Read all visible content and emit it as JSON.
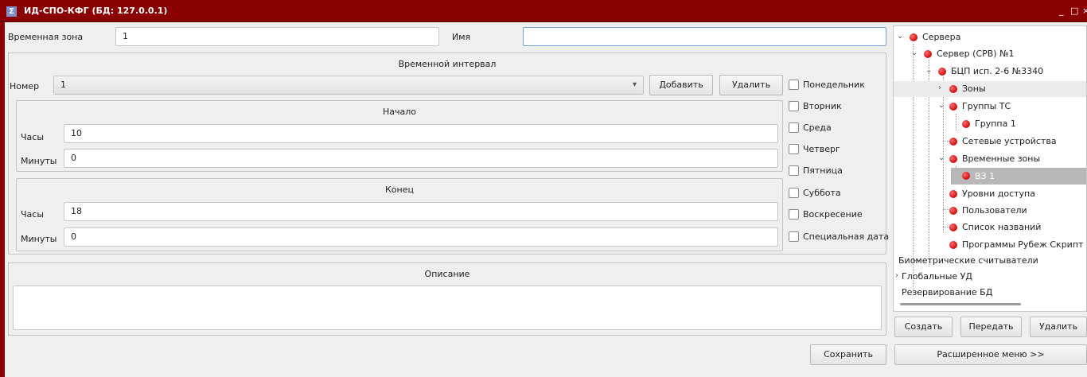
{
  "window": {
    "title": "ИД-СПО-КФГ (БД: 127.0.0.1)",
    "icon": "sigma-icon",
    "minimize": "_",
    "maximize": "□",
    "close": "×",
    "colors": {
      "titlebar": "#8b0000",
      "selection": "#b8b8b8",
      "node": "#d21a1a"
    }
  },
  "form": {
    "timezone_label": "Временная зона",
    "timezone_value": "1",
    "name_label": "Имя",
    "name_value": ""
  },
  "interval": {
    "title": "Временной интервал",
    "number_label": "Номер",
    "number_value": "1",
    "add_button": "Добавить",
    "delete_button": "Удалить",
    "start": {
      "title": "Начало",
      "hours_label": "Часы",
      "hours_value": "10",
      "minutes_label": "Минуты",
      "minutes_value": "0"
    },
    "end": {
      "title": "Конец",
      "hours_label": "Часы",
      "hours_value": "18",
      "minutes_label": "Минуты",
      "minutes_value": "0"
    },
    "days": [
      {
        "label": "Понедельник",
        "checked": false
      },
      {
        "label": "Вторник",
        "checked": false
      },
      {
        "label": "Среда",
        "checked": false
      },
      {
        "label": "Четверг",
        "checked": false
      },
      {
        "label": "Пятница",
        "checked": false
      },
      {
        "label": "Суббота",
        "checked": false
      },
      {
        "label": "Воскресение",
        "checked": false
      },
      {
        "label": "Специальная дата",
        "checked": false
      }
    ]
  },
  "description": {
    "title": "Описание",
    "value": ""
  },
  "save_button": "Сохранить",
  "tree": {
    "nodes": [
      {
        "label": "Сервера"
      },
      {
        "label": "Сервер (СРВ) №1"
      },
      {
        "label": "БЦП исп. 2-6 №3340"
      },
      {
        "label": "Зоны"
      },
      {
        "label": "Группы ТС"
      },
      {
        "label": "Группа 1"
      },
      {
        "label": "Сетевые устройства"
      },
      {
        "label": "Временные зоны"
      },
      {
        "label": "ВЗ 1"
      },
      {
        "label": "Уровни доступа"
      },
      {
        "label": "Пользователи"
      },
      {
        "label": "Список названий"
      },
      {
        "label": "Программы Рубеж Скрипт"
      },
      {
        "label": "Биометрические считыватели"
      },
      {
        "label": "Глобальные УД"
      },
      {
        "label": "Резервирование БД"
      }
    ],
    "create_button": "Создать",
    "transfer_button": "Передать",
    "delete_button": "Удалить",
    "extended_menu_button": "Расширенное меню >>"
  }
}
